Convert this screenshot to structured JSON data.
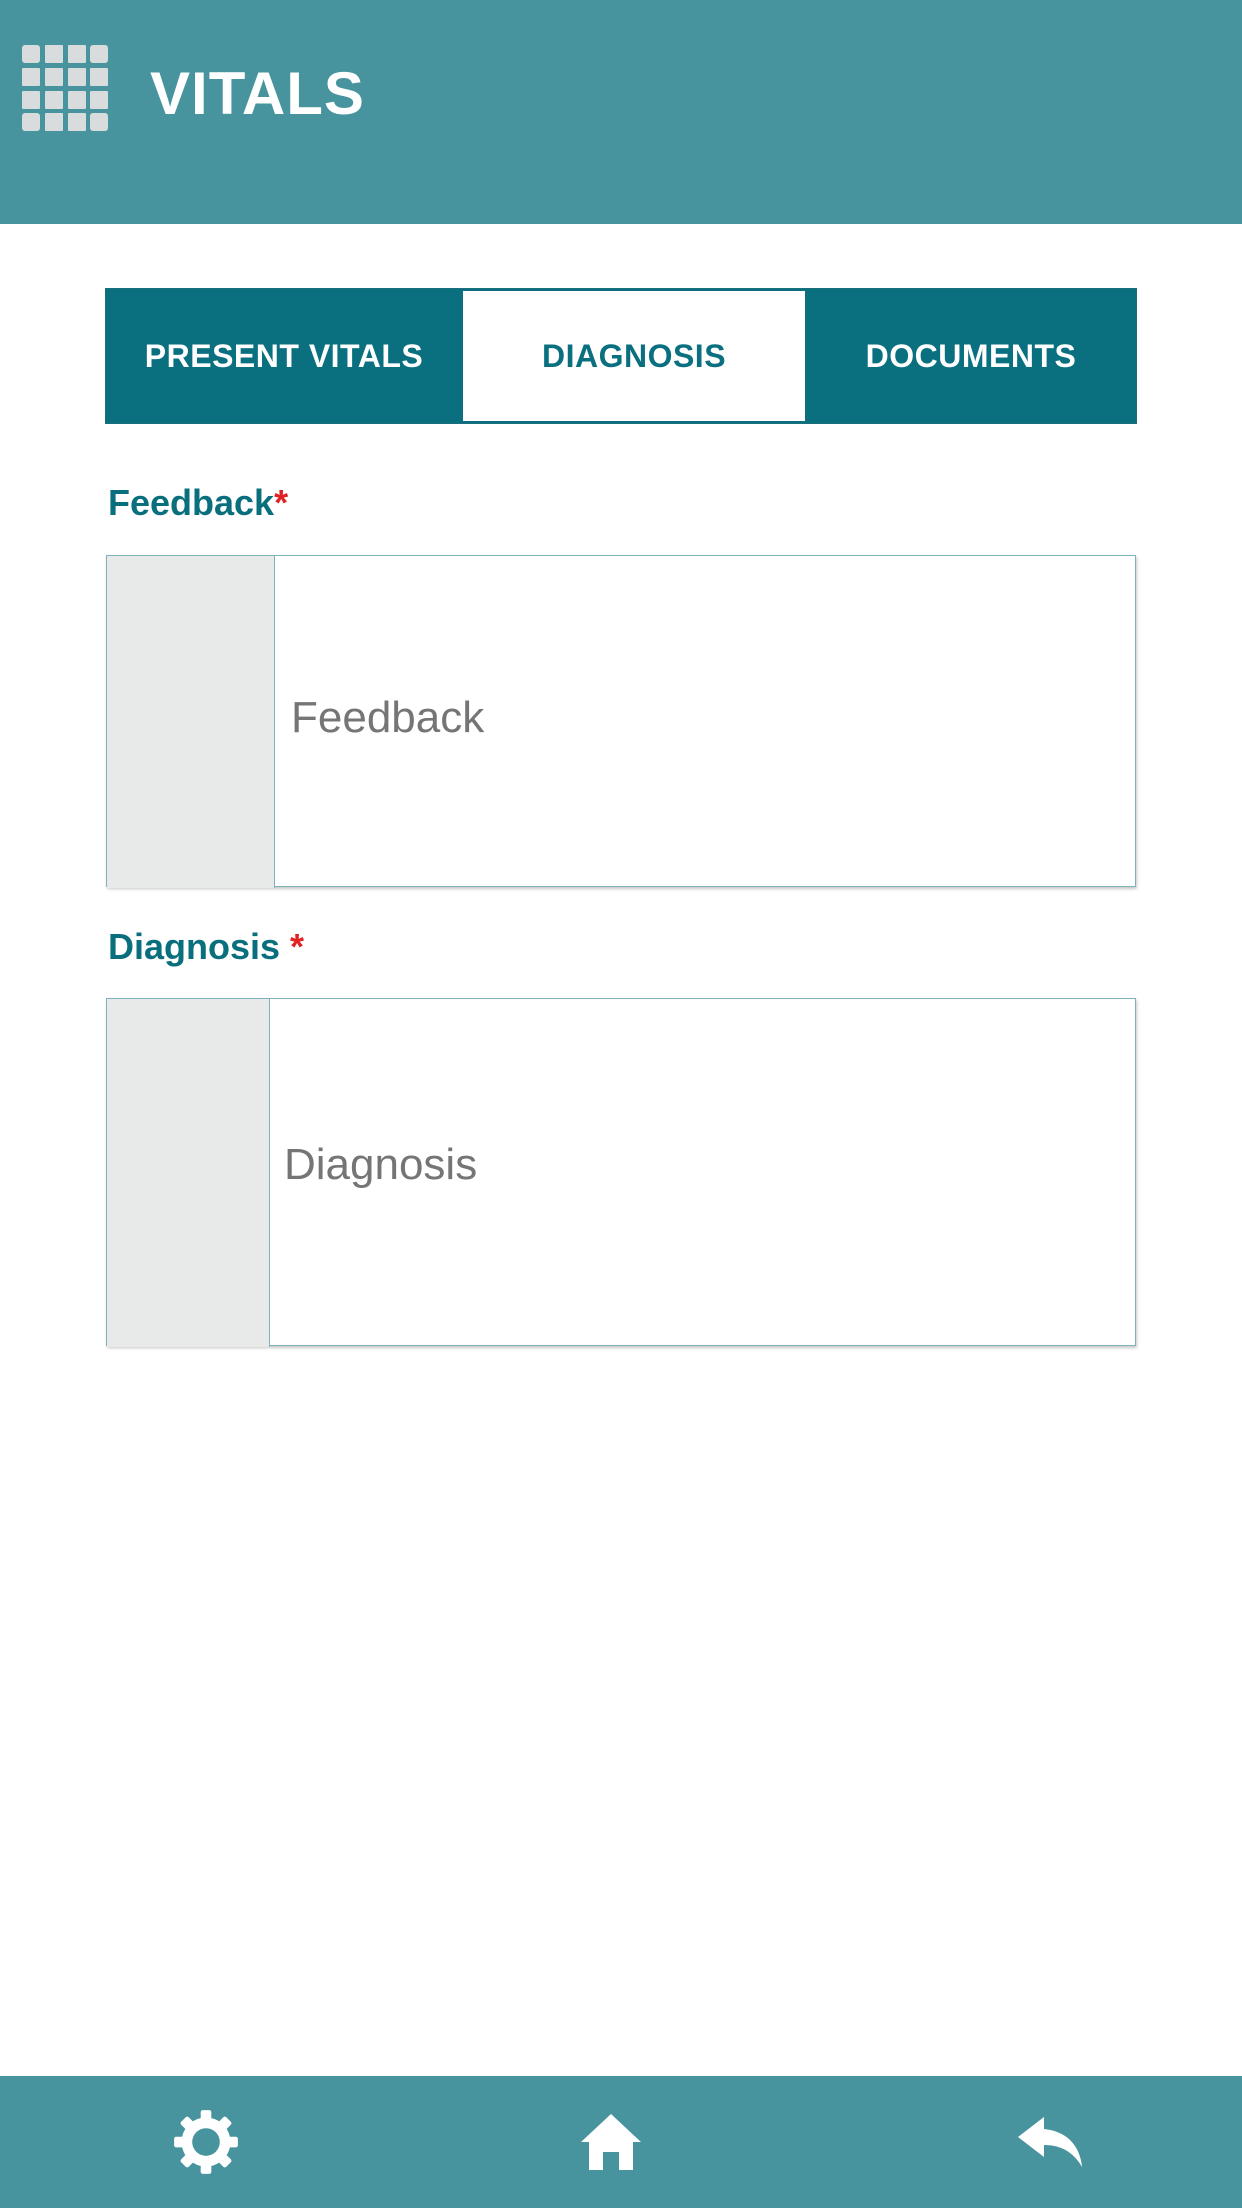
{
  "header": {
    "title": "VITALS",
    "menu_icon": "grid-menu-icon"
  },
  "tabs": [
    {
      "label": "PRESENT VITALS",
      "active": false
    },
    {
      "label": "DIAGNOSIS",
      "active": true
    },
    {
      "label": "DOCUMENTS",
      "active": false
    }
  ],
  "form": {
    "feedback": {
      "label": "Feedback",
      "required_mark": "*",
      "placeholder": "Feedback",
      "value": ""
    },
    "diagnosis": {
      "label": "Diagnosis ",
      "required_mark": "*",
      "placeholder": "Diagnosis",
      "value": ""
    }
  },
  "bottom_nav": {
    "settings_icon": "gear-icon",
    "home_icon": "home-icon",
    "back_icon": "reply-back-icon"
  },
  "colors": {
    "header_bg": "#47949f",
    "tab_bg": "#0a7080",
    "label": "#0a6f7d",
    "required": "#e02222",
    "field_side": "#e8eaea"
  }
}
